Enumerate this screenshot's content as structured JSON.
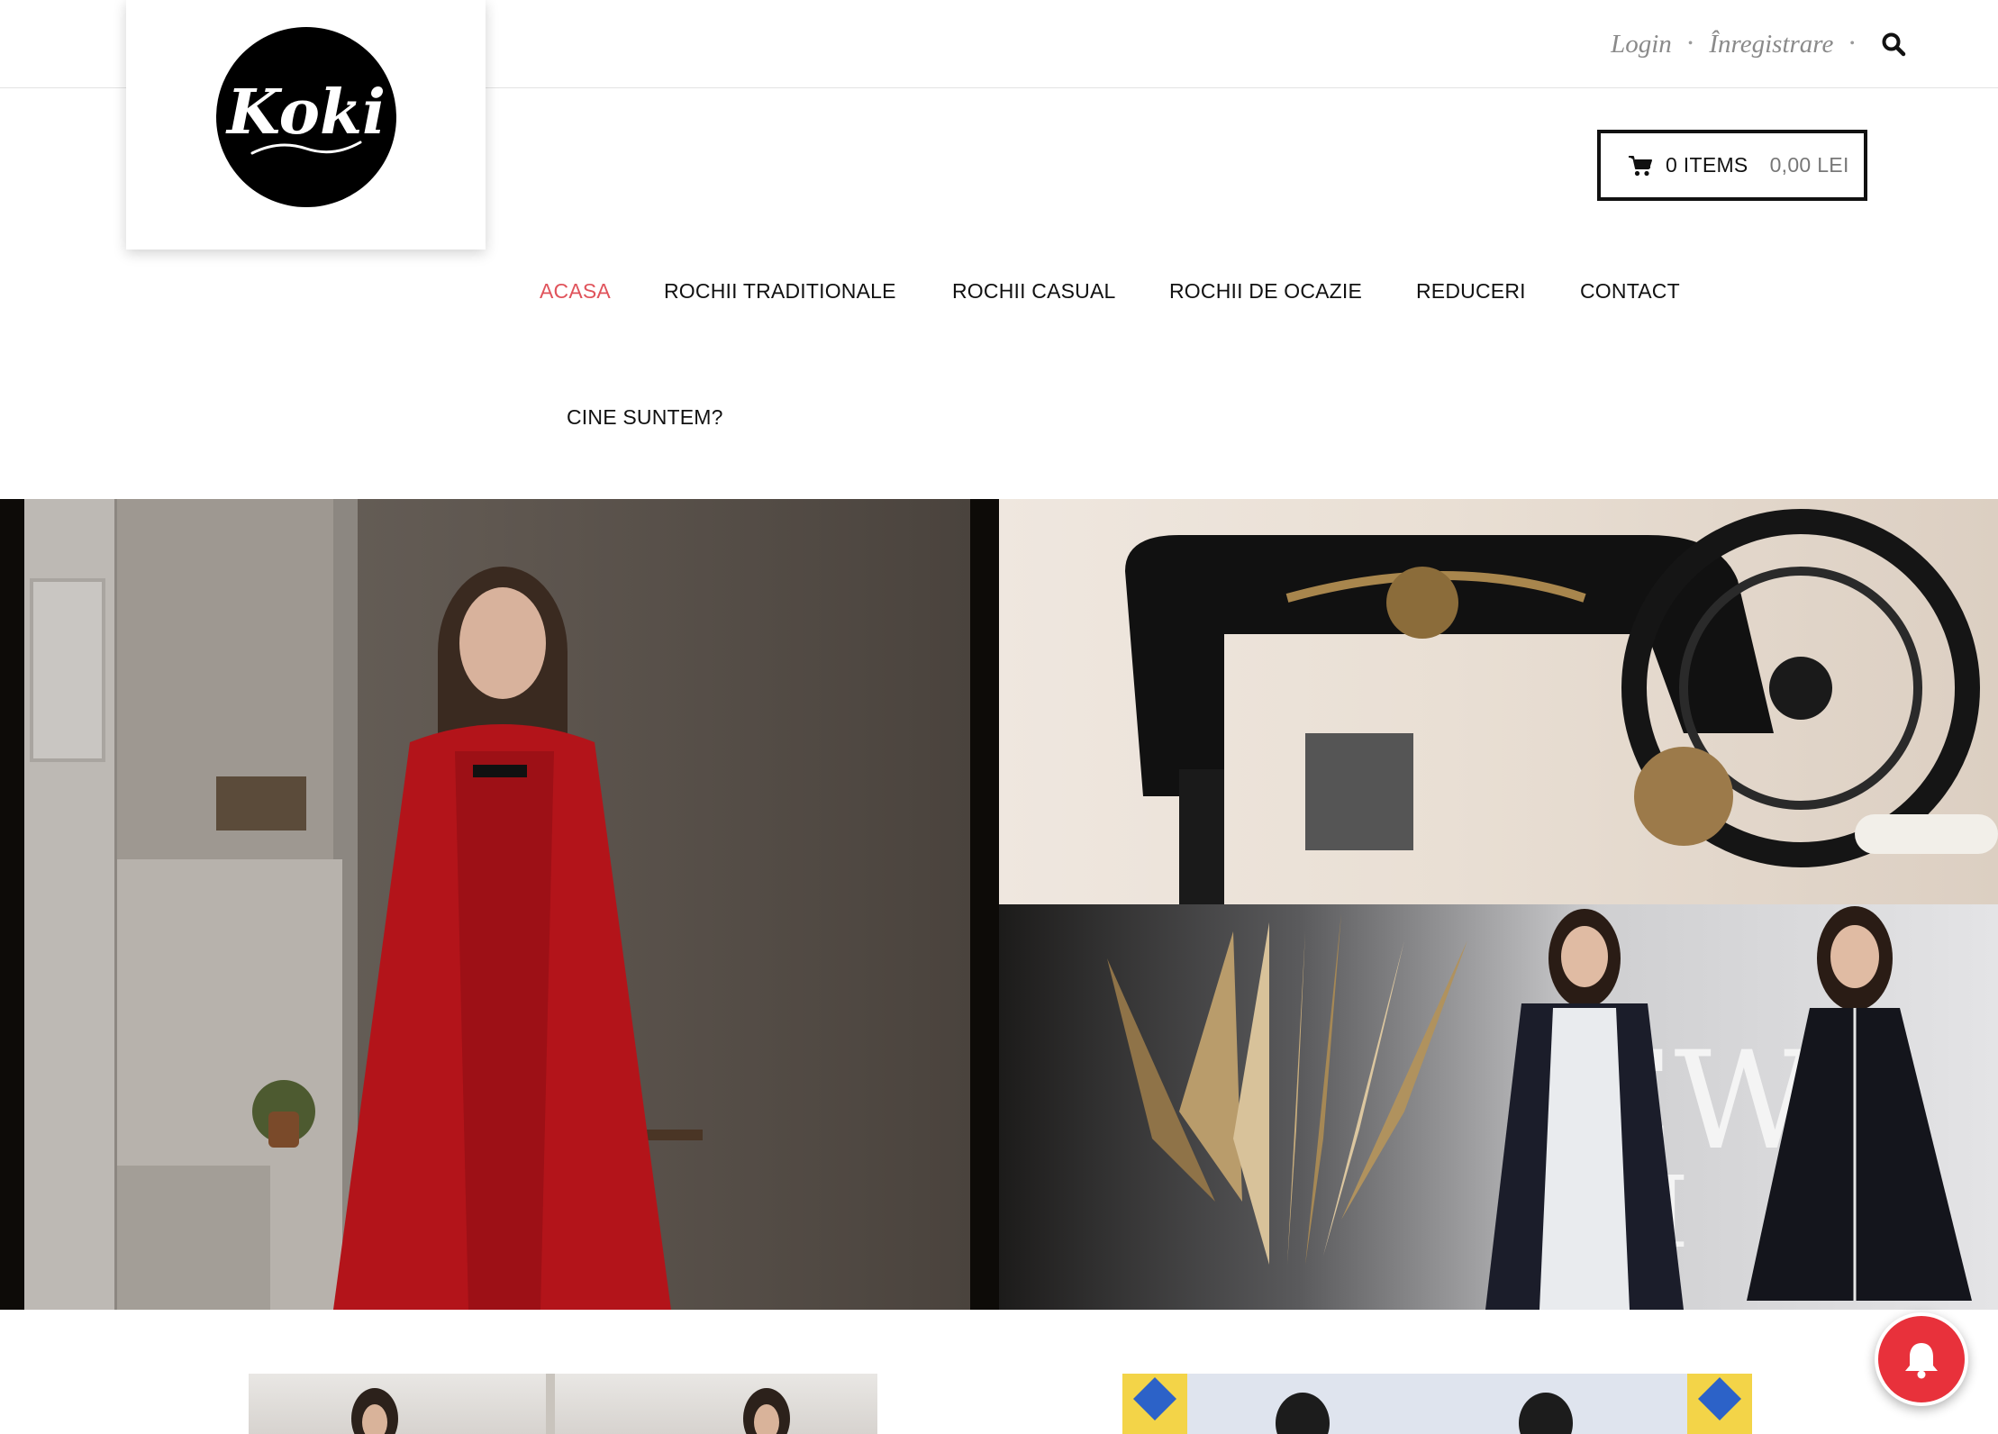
{
  "header": {
    "login_label": "Login",
    "register_label": "Înregistrare",
    "separator": "•",
    "search_icon": "search-icon"
  },
  "logo": {
    "text": "Koki",
    "alt": "Koki logo"
  },
  "cart": {
    "icon": "cart-icon",
    "items_label": "0 ITEMS",
    "total_label": "0,00 LEI"
  },
  "nav": {
    "items": [
      {
        "label": "ACASA",
        "active": true
      },
      {
        "label": "ROCHII TRADITIONALE",
        "active": false
      },
      {
        "label": "ROCHII CASUAL",
        "active": false
      },
      {
        "label": "ROCHII DE OCAZIE",
        "active": false
      },
      {
        "label": "REDUCERI",
        "active": false
      },
      {
        "label": "CONTACT",
        "active": false
      },
      {
        "label": "CINE SUNTEM?",
        "active": false
      }
    ]
  },
  "colors": {
    "accent": "#e0535b",
    "notification": "#e8313b"
  },
  "notification": {
    "icon": "bell-icon"
  }
}
